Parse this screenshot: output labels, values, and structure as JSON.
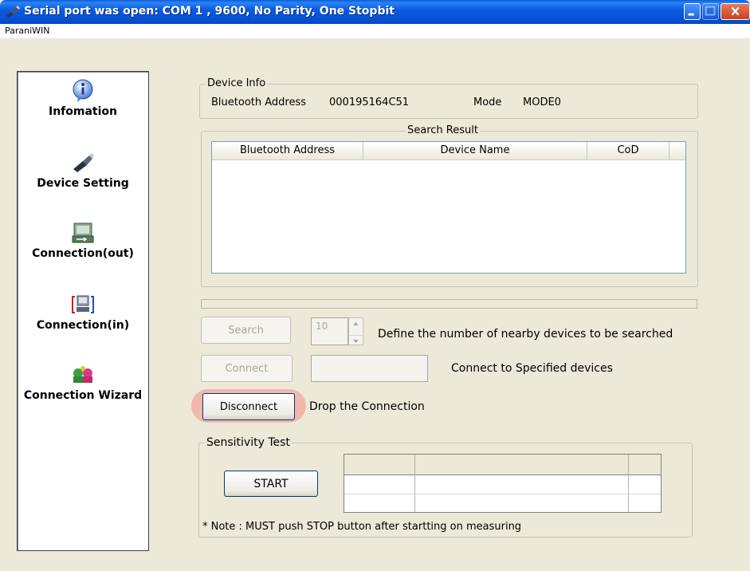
{
  "window": {
    "title": "Serial port was open: COM 1 , 9600, No Parity, One Stopbit",
    "colors": {
      "titlebar": "#0b5ae0",
      "face": "#ece9d8",
      "highlight": "#f5aaa0"
    }
  },
  "menu": {
    "app_label": "ParaniWIN"
  },
  "sidebar": {
    "items": [
      {
        "label": "Infomation",
        "icon": "info-icon"
      },
      {
        "label": "Device Setting",
        "icon": "device-setting-icon"
      },
      {
        "label": "Connection(out)",
        "icon": "connection-out-icon"
      },
      {
        "label": "Connection(in)",
        "icon": "connection-in-icon"
      },
      {
        "label": "Connection Wizard",
        "icon": "connection-wizard-icon"
      }
    ]
  },
  "device_info": {
    "legend": "Device Info",
    "bt_address_label": "Bluetooth Address",
    "bt_address_value": "000195164C51",
    "mode_label": "Mode",
    "mode_value": "MODE0"
  },
  "search_result": {
    "legend": "Search Result",
    "columns": [
      "Bluetooth Address",
      "Device Name",
      "CoD"
    ],
    "rows": []
  },
  "controls": {
    "search_button": "Search",
    "search_count": "10",
    "search_desc": "Define the number of nearby devices to be searched",
    "connect_button": "Connect",
    "connect_value": "",
    "connect_desc": "Connect to Specified devices",
    "disconnect_button": "Disconnect",
    "disconnect_desc": "Drop the Connection"
  },
  "sensitivity": {
    "legend": "Sensitivity Test",
    "start_button": "START",
    "note": "* Note : MUST push STOP button after startting on measuring"
  }
}
